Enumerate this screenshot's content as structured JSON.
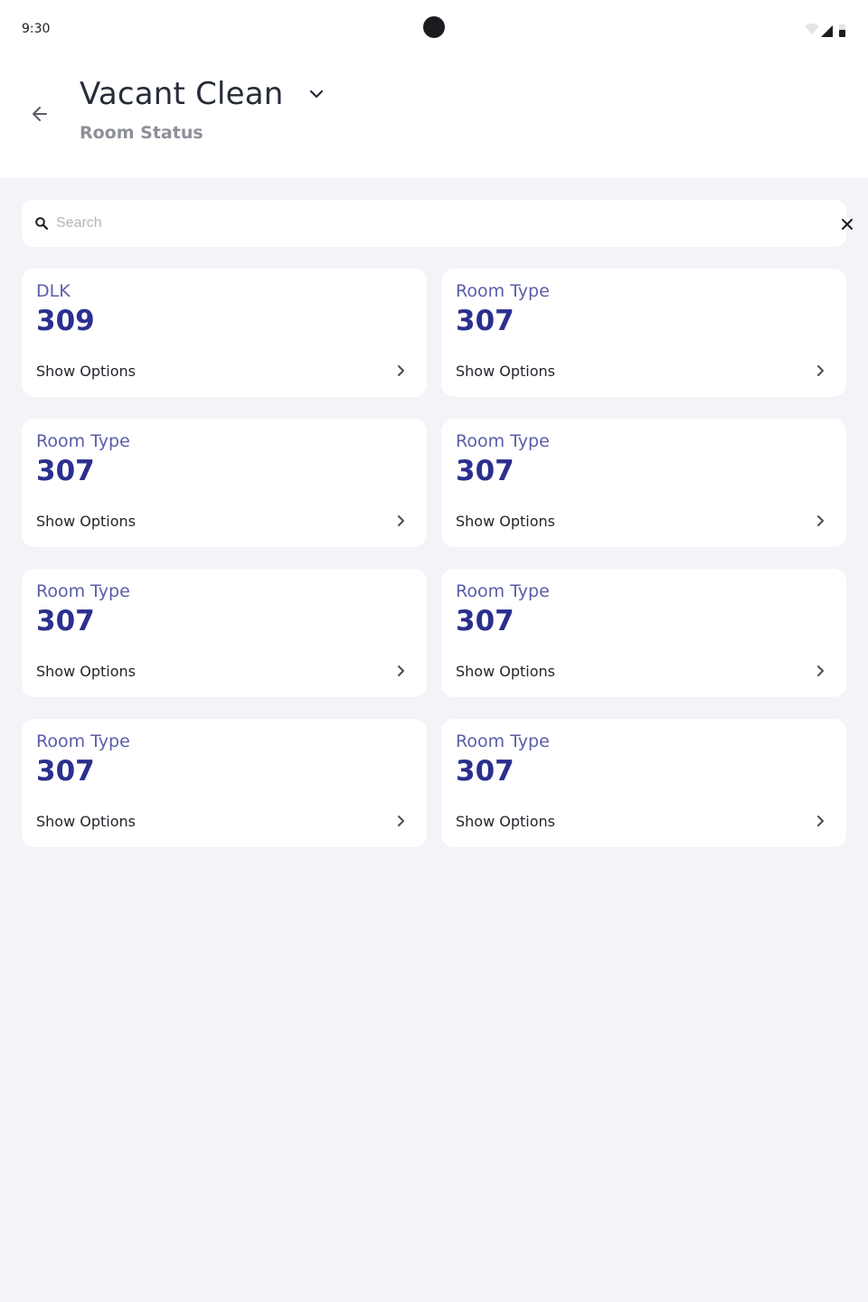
{
  "status_bar": {
    "time": "9:30",
    "icons": [
      "wifi-icon",
      "signal-icon",
      "battery-icon"
    ]
  },
  "header": {
    "title": "Vacant Clean",
    "subtitle": "Room Status",
    "back_icon": "arrow-left-icon",
    "dropdown_icon": "chevron-down-icon"
  },
  "search": {
    "placeholder": "Search",
    "value": ""
  },
  "rooms": [
    {
      "type": "DLK",
      "number": "309",
      "action": "Show Options"
    },
    {
      "type": "Room Type",
      "number": "307",
      "action": "Show Options"
    },
    {
      "type": "Room Type",
      "number": "307",
      "action": "Show Options"
    },
    {
      "type": "Room Type",
      "number": "307",
      "action": "Show Options"
    },
    {
      "type": "Room Type",
      "number": "307",
      "action": "Show Options"
    },
    {
      "type": "Room Type",
      "number": "307",
      "action": "Show Options"
    },
    {
      "type": "Room Type",
      "number": "307",
      "action": "Show Options"
    },
    {
      "type": "Room Type",
      "number": "307",
      "action": "Show Options"
    }
  ],
  "colors": {
    "background": "#f3f3f8",
    "room_type": "#5a5ea8",
    "room_number": "#2b2f8e",
    "title": "#262c38"
  }
}
